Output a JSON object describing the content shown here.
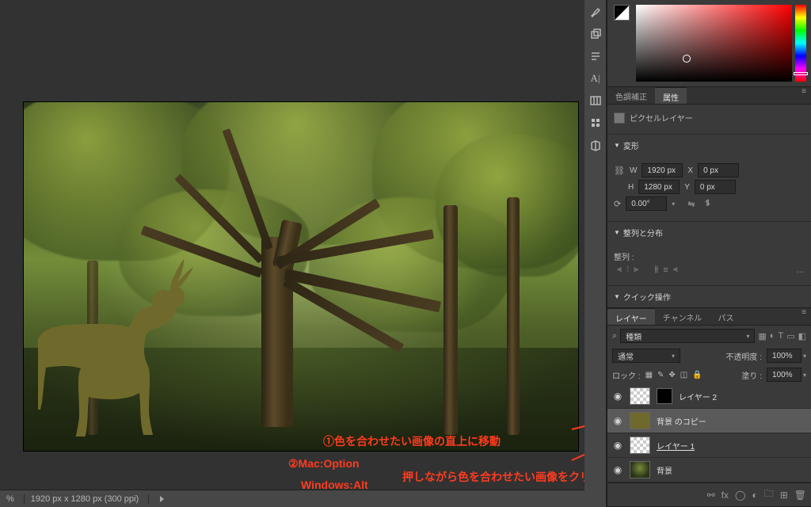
{
  "statusbar": {
    "zoom": "%",
    "dimensions": "1920 px x 1280 px (300 ppi)"
  },
  "color_panel": {},
  "properties_panel": {
    "tabs": {
      "color_adjust": "色調補正",
      "properties": "属性"
    },
    "pixel_layer": "ピクセルレイヤー",
    "transform_header": "変形",
    "w_label": "W",
    "w_value": "1920 px",
    "x_label": "X",
    "x_value": "0 px",
    "h_label": "H",
    "h_value": "1280 px",
    "y_label": "Y",
    "y_value": "0 px",
    "rotation": "0.00°",
    "align_header": "整列と分布",
    "align_label": "整列 :",
    "quick_ops_header": "クイック操作"
  },
  "layers_panel": {
    "tabs": {
      "layers": "レイヤー",
      "channels": "チャンネル",
      "paths": "パス"
    },
    "filter": "種類",
    "blend_mode": "通常",
    "opacity_label": "不透明度 :",
    "opacity_value": "100%",
    "lock_label": "ロック :",
    "fill_label": "塗り :",
    "fill_value": "100%",
    "layers": [
      {
        "name": "レイヤー 2"
      },
      {
        "name": "背景 のコピー"
      },
      {
        "name": "レイヤー 1"
      },
      {
        "name": "背景"
      }
    ]
  },
  "annotations": {
    "line1": "①色を合わせたい画像の直上に移動",
    "line2a": "②Mac:Option",
    "line2b": "Windows:Alt",
    "line3": "押しながら色を合わせたい画像をクリック"
  }
}
